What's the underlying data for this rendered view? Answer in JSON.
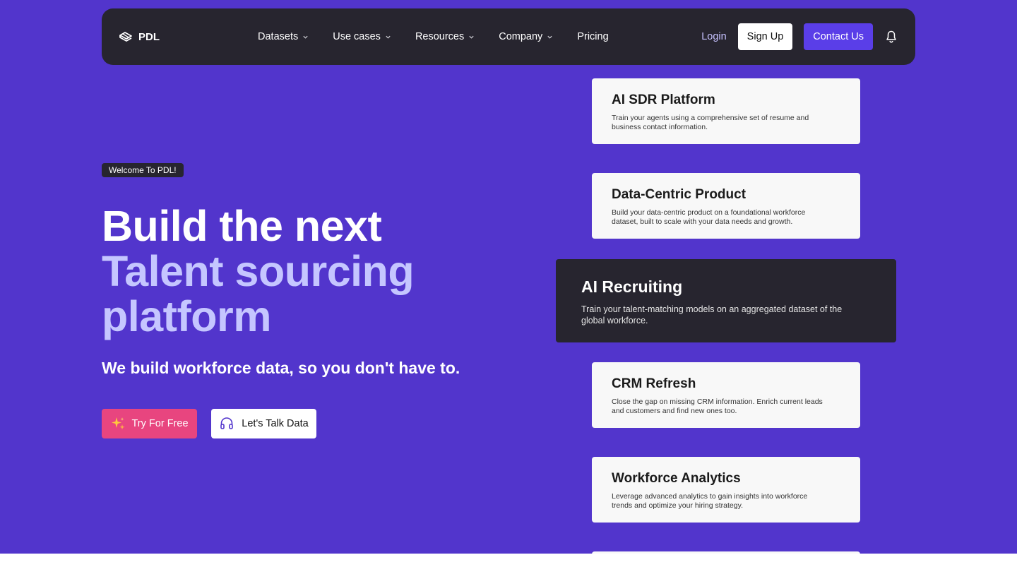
{
  "nav": {
    "brand": "PDL",
    "links": [
      {
        "label": "Datasets",
        "has_dropdown": true
      },
      {
        "label": "Use cases",
        "has_dropdown": true
      },
      {
        "label": "Resources",
        "has_dropdown": true
      },
      {
        "label": "Company",
        "has_dropdown": true
      },
      {
        "label": "Pricing",
        "has_dropdown": false
      }
    ],
    "login": "Login",
    "signup": "Sign Up",
    "contact": "Contact Us"
  },
  "hero": {
    "badge": "Welcome To PDL!",
    "headline_line1": "Build the next",
    "headline_line2": "Talent sourcing",
    "headline_line3": "platform",
    "subhead": "We build workforce data, so you don't have to.",
    "cta_primary": "Try For Free",
    "cta_secondary": "Let's Talk Data"
  },
  "cards": [
    {
      "title": "AI SDR Platform",
      "desc": "Train your agents using a comprehensive set of resume and business contact information."
    },
    {
      "title": "Data-Centric Product",
      "desc": "Build your data-centric product on a foundational workforce dataset, built to scale with your data needs and growth."
    },
    {
      "title": "AI Recruiting",
      "desc": "Train your talent-matching models on an aggregated dataset of the global workforce.",
      "active": true
    },
    {
      "title": "CRM Refresh",
      "desc": "Close the gap on missing CRM information. Enrich current leads and customers and find new ones too."
    },
    {
      "title": "Workforce Analytics",
      "desc": "Leverage advanced analytics to gain insights into workforce trends and optimize your hiring strategy."
    }
  ],
  "colors": {
    "hero_bg": "#5235cc",
    "nav_bg": "#27252f",
    "accent_light": "#c5c6ff",
    "contact_btn": "#5a3ee8",
    "try_btn": "#e8457f"
  }
}
